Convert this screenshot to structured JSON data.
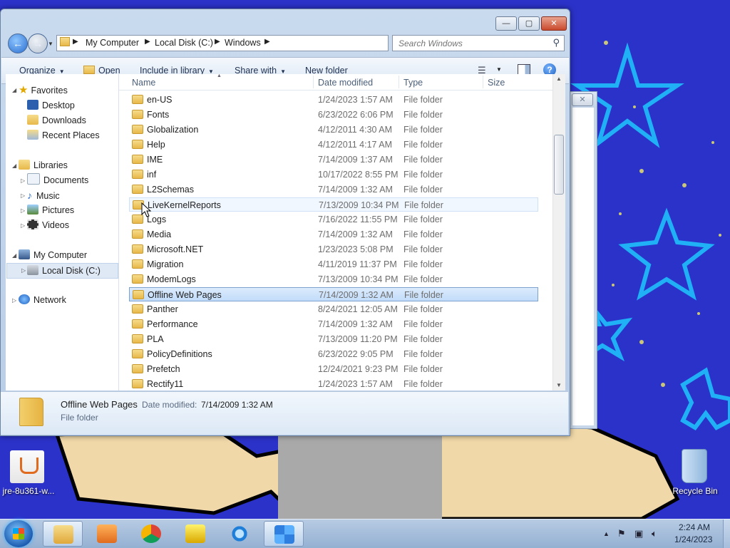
{
  "window": {
    "title": "Windows",
    "minimize_label": "—",
    "maximize_label": "▢",
    "close_label": "✕"
  },
  "address_bar": {
    "crumbs": [
      "My Computer",
      "Local Disk (C:)",
      "Windows"
    ],
    "separator": "▶"
  },
  "search": {
    "placeholder": "Search Windows"
  },
  "toolbar": {
    "organize": "Organize",
    "open": "Open",
    "include_in_library": "Include in library",
    "share_with": "Share with",
    "new_folder": "New folder"
  },
  "nav_pane": {
    "favorites": "Favorites",
    "desktop": "Desktop",
    "downloads": "Downloads",
    "recent_places": "Recent Places",
    "libraries": "Libraries",
    "documents": "Documents",
    "music": "Music",
    "pictures": "Pictures",
    "videos": "Videos",
    "my_computer": "My Computer",
    "local_disk": "Local Disk (C:)",
    "network": "Network"
  },
  "columns": {
    "name": "Name",
    "date_modified": "Date modified",
    "type": "Type",
    "size": "Size"
  },
  "files": [
    {
      "name": "en-US",
      "date": "1/24/2023 1:57 AM",
      "type": "File folder"
    },
    {
      "name": "Fonts",
      "date": "6/23/2022 6:06 PM",
      "type": "File folder"
    },
    {
      "name": "Globalization",
      "date": "4/12/2011 4:30 AM",
      "type": "File folder"
    },
    {
      "name": "Help",
      "date": "4/12/2011 4:17 AM",
      "type": "File folder"
    },
    {
      "name": "IME",
      "date": "7/14/2009 1:37 AM",
      "type": "File folder"
    },
    {
      "name": "inf",
      "date": "10/17/2022 8:55 PM",
      "type": "File folder"
    },
    {
      "name": "L2Schemas",
      "date": "7/14/2009 1:32 AM",
      "type": "File folder"
    },
    {
      "name": "LiveKernelReports",
      "date": "7/13/2009 10:34 PM",
      "type": "File folder"
    },
    {
      "name": "Logs",
      "date": "7/16/2022 11:55 PM",
      "type": "File folder"
    },
    {
      "name": "Media",
      "date": "7/14/2009 1:32 AM",
      "type": "File folder"
    },
    {
      "name": "Microsoft.NET",
      "date": "1/23/2023 5:08 PM",
      "type": "File folder"
    },
    {
      "name": "Migration",
      "date": "4/11/2019 11:37 PM",
      "type": "File folder"
    },
    {
      "name": "ModemLogs",
      "date": "7/13/2009 10:34 PM",
      "type": "File folder"
    },
    {
      "name": "Offline Web Pages",
      "date": "7/14/2009 1:32 AM",
      "type": "File folder"
    },
    {
      "name": "Panther",
      "date": "8/24/2021 12:05 AM",
      "type": "File folder"
    },
    {
      "name": "Performance",
      "date": "7/14/2009 1:32 AM",
      "type": "File folder"
    },
    {
      "name": "PLA",
      "date": "7/13/2009 11:20 PM",
      "type": "File folder"
    },
    {
      "name": "PolicyDefinitions",
      "date": "6/23/2022 9:05 PM",
      "type": "File folder"
    },
    {
      "name": "Prefetch",
      "date": "12/24/2021 9:23 PM",
      "type": "File folder"
    },
    {
      "name": "Rectify11",
      "date": "1/24/2023 1:57 AM",
      "type": "File folder"
    }
  ],
  "details": {
    "name": "Offline Web Pages",
    "date_label": "Date modified:",
    "date_value": "7/14/2009 1:32 AM",
    "type": "File folder"
  },
  "desktop_icons": {
    "java": "jre-8u361-w...",
    "recycle_bin": "Recycle Bin"
  },
  "taskbar": {
    "time": "2:24 AM",
    "date": "1/24/2023"
  },
  "colors": {
    "desktop_bg": "#2b32c9",
    "selection": "#c1dcfa",
    "accent": "#1f5fc0"
  },
  "icons": {
    "back": "back-arrow-icon",
    "forward": "forward-arrow-icon",
    "search": "magnifier-icon",
    "folder": "folder-icon",
    "help": "help-icon"
  }
}
